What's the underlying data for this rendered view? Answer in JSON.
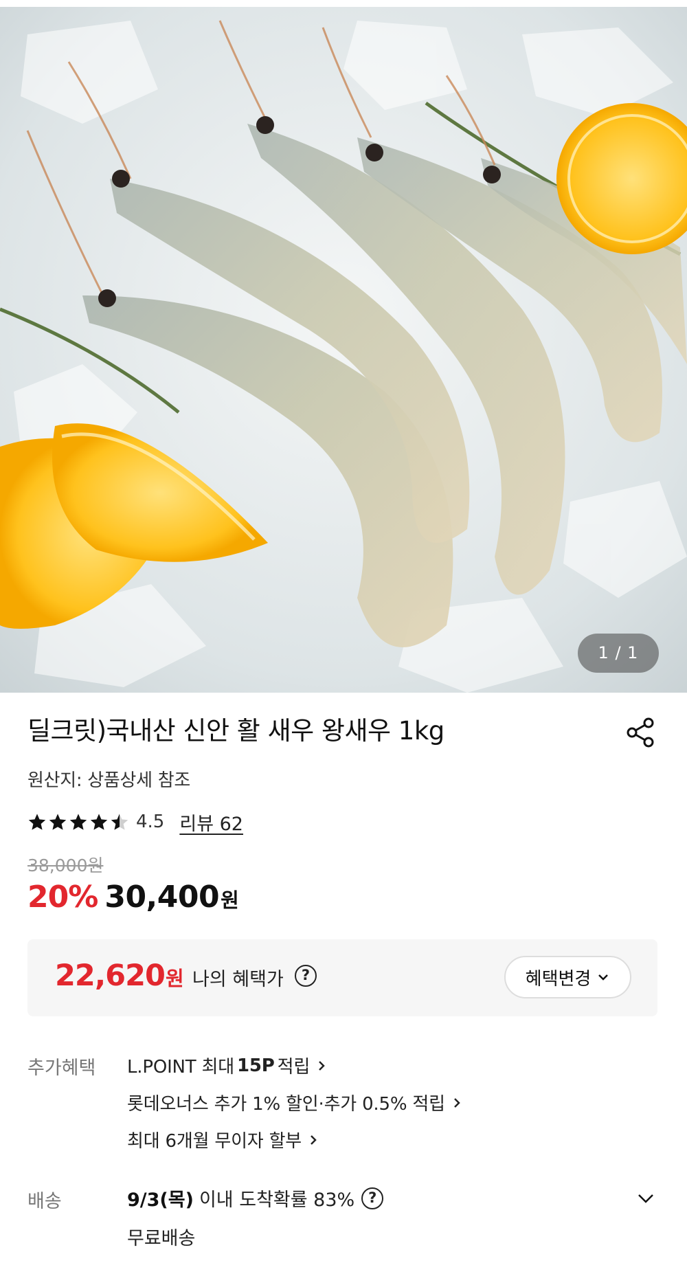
{
  "product": {
    "image_alt": "새우",
    "image_counter": "1 / 1",
    "title": "딜크릿)국내산 신안 활 새우 왕새우 1kg",
    "origin": "원산지: 상품상세 참조",
    "rating": {
      "stars": 4.5,
      "value": "4.5",
      "review_label": "리뷰 62"
    },
    "original_price": "38,000원",
    "discount": "20%",
    "price": "30,400",
    "price_unit": "원"
  },
  "benefit": {
    "price": "22,620",
    "unit": "원",
    "label": "나의 혜택가",
    "help": "?",
    "change_label": "혜택변경"
  },
  "extra": {
    "label": "추가혜택",
    "line1_pre": "L.POINT 최대",
    "line1_bold": "15P",
    "line1_post": "적립",
    "line2": "롯데오너스 추가 1% 할인·추가 0.5% 적립",
    "line3": "최대 6개월 무이자 할부"
  },
  "delivery": {
    "label": "배송",
    "date": "9/3(목)",
    "text": "이내 도착확률 83%",
    "help": "?",
    "free": "무료배송"
  },
  "colors": {
    "accent": "#e2272e",
    "text": "#111111",
    "muted": "#777777",
    "box": "#f6f6f6"
  },
  "icons": {
    "share": "share-icon",
    "star": "star-icon",
    "chevron": "chevron-down-icon",
    "arrow": "chevron-right-icon"
  }
}
